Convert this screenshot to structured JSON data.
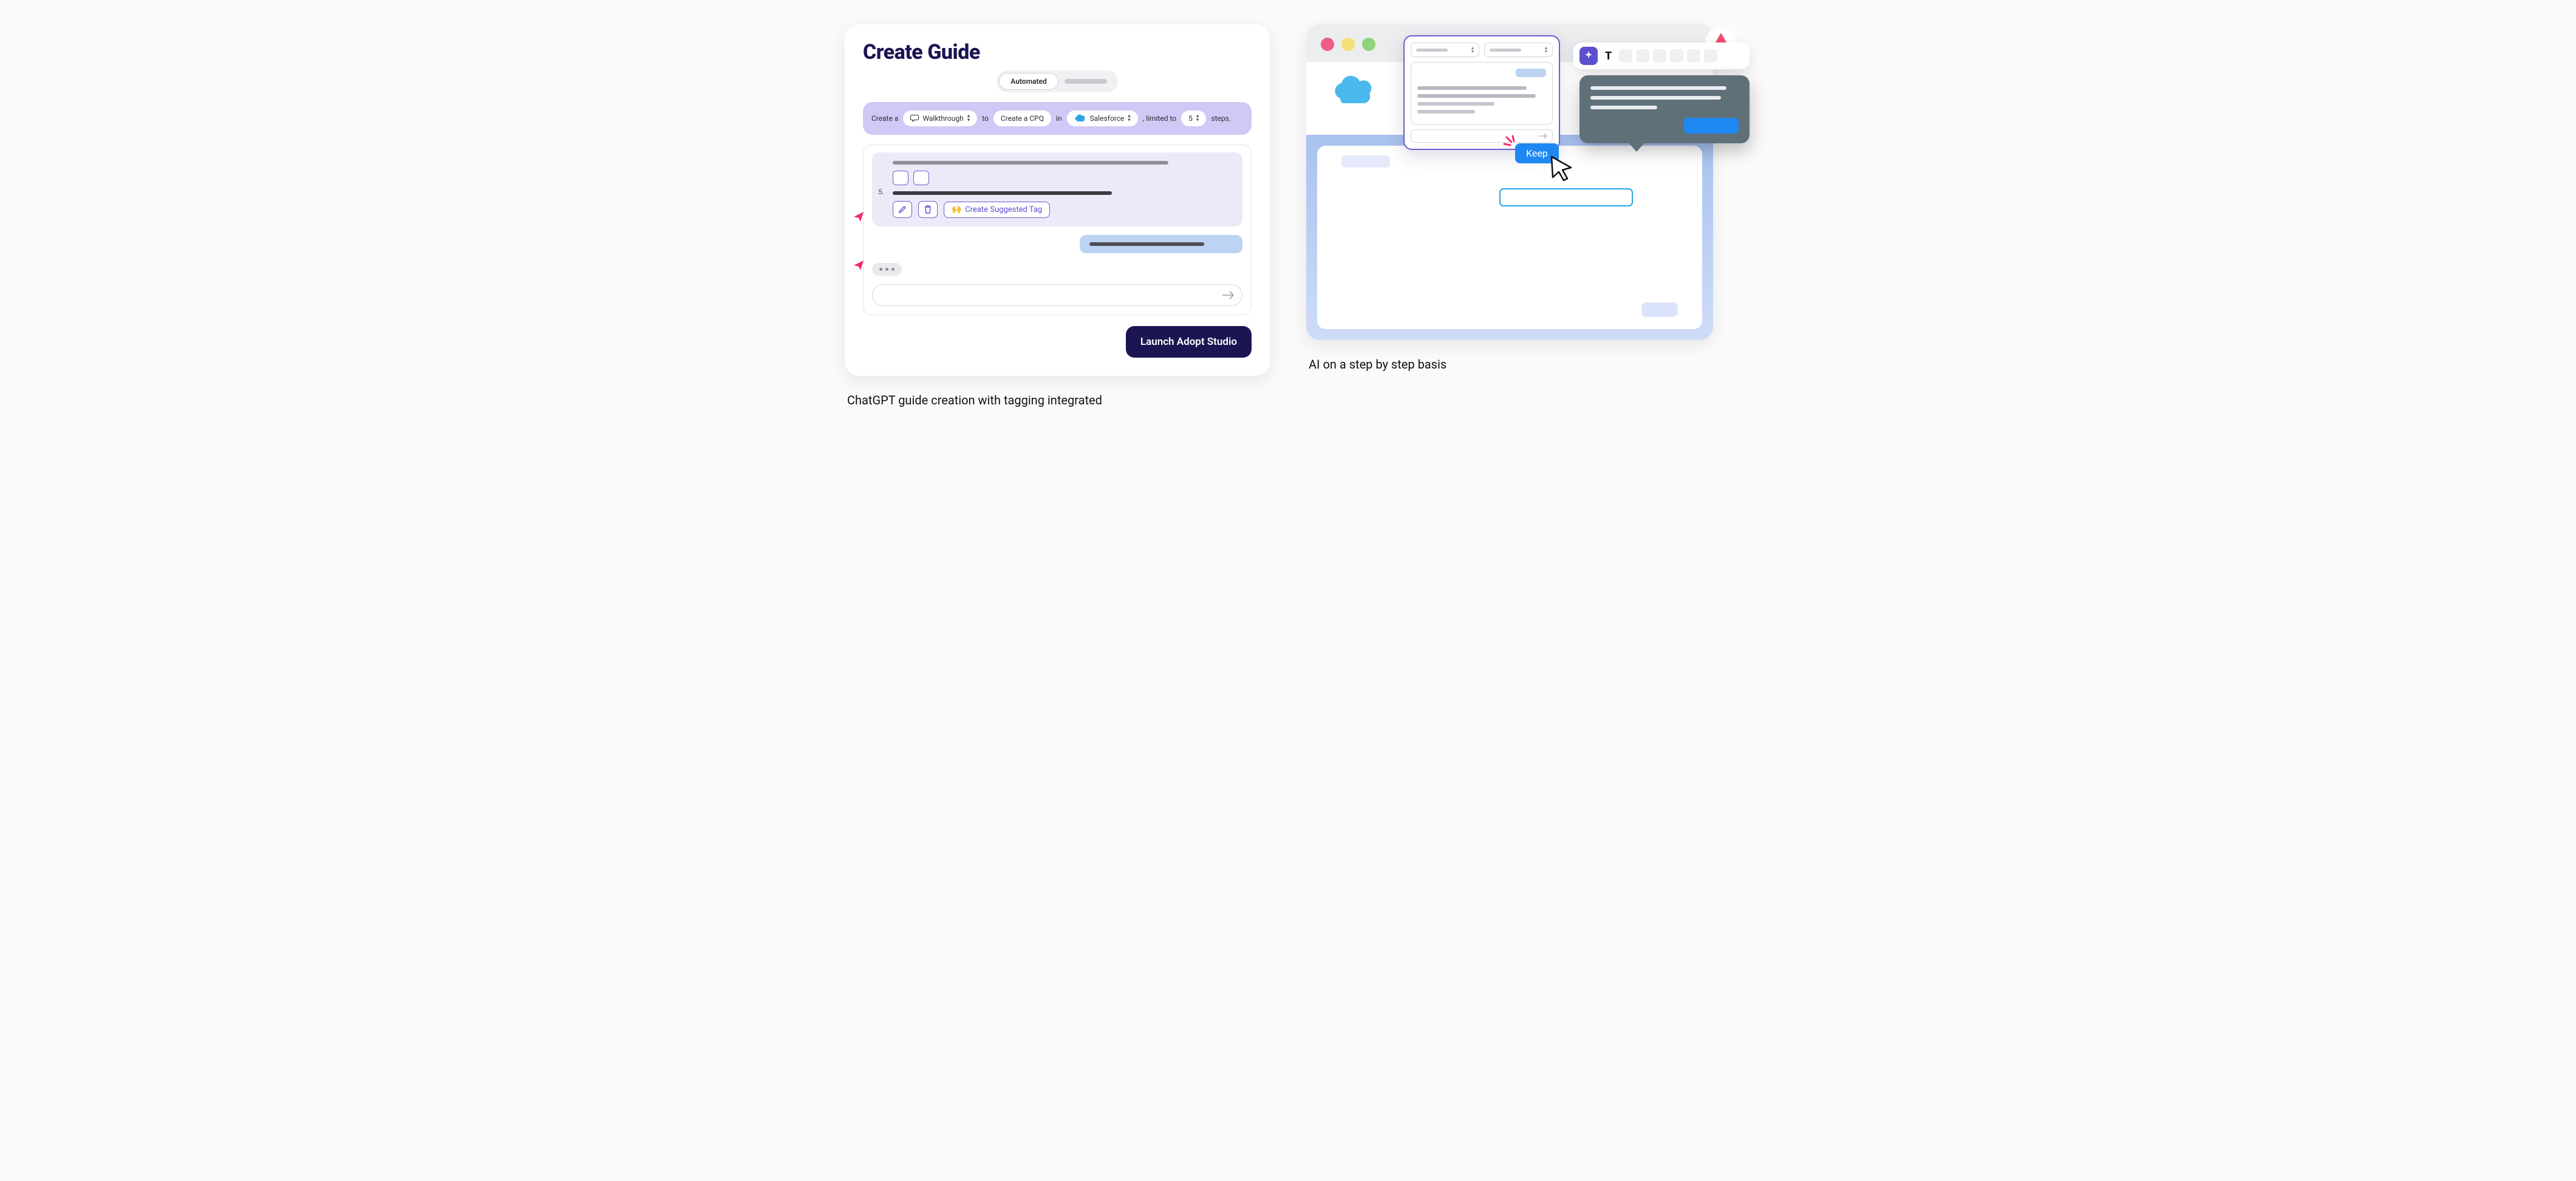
{
  "left": {
    "title": "Create Guide",
    "mode_active": "Automated",
    "sentence": {
      "t1": "Create a",
      "walkthrough": "Walkthrough",
      "t2": "to",
      "action": "Create a CPQ",
      "t3": "in",
      "app": "Salesforce",
      "t4": ", limited to",
      "steps": "5",
      "t5": "steps."
    },
    "step_number": "5.",
    "create_tag": "Create Suggested Tag",
    "launch": "Launch Adopt Studio"
  },
  "right": {
    "keep": "Keep",
    "toolbar_T": "T"
  },
  "captions": {
    "left": "ChatGPT guide creation with tagging integrated",
    "right": "AI on a step by step basis"
  },
  "colors": {
    "brand_purple": "#6b5ed0",
    "deep_navy": "#1b1552",
    "sf_blue": "#2aa4e6",
    "action_blue": "#1e88f2",
    "accent_pink": "#ef2d6d"
  }
}
